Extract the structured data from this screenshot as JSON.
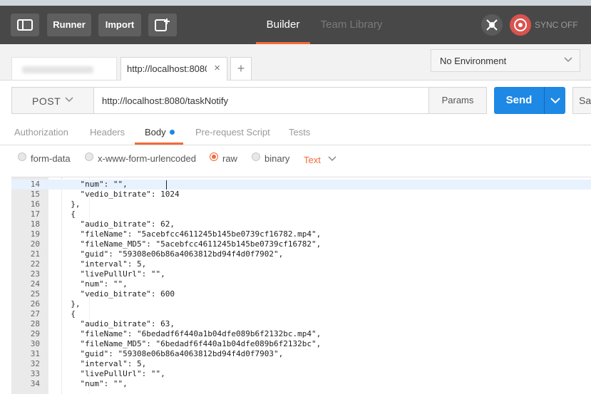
{
  "header": {
    "runner_label": "Runner",
    "import_label": "Import",
    "tabs": [
      {
        "label": "Builder",
        "active": true
      },
      {
        "label": "Team Library",
        "active": false
      }
    ],
    "sync_label": "SYNC OFF"
  },
  "tabs_row": {
    "active_tab_label": "http://localhost:8080",
    "add_tab_label": "+",
    "close_label": "×",
    "environment": "No Environment"
  },
  "request": {
    "method": "POST",
    "url": "http://localhost:8080/taskNotify",
    "params_label": "Params",
    "send_label": "Send",
    "save_label": "Sa"
  },
  "subtabs": [
    "Authorization",
    "Headers",
    "Body",
    "Pre-request Script",
    "Tests"
  ],
  "body_options": {
    "form_data": "form-data",
    "urlencoded": "x-www-form-urlencoded",
    "raw": "raw",
    "binary": "binary",
    "text_type": "Text"
  },
  "editor": {
    "lines": [
      {
        "n": "14",
        "t": "    \"num\": \"\","
      },
      {
        "n": "15",
        "t": "    \"vedio_bitrate\": 1024"
      },
      {
        "n": "16",
        "t": "  },"
      },
      {
        "n": "17",
        "t": "  {"
      },
      {
        "n": "18",
        "t": "    \"audio_bitrate\": 62,"
      },
      {
        "n": "19",
        "t": "    \"fileName\": \"5acebfcc4611245b145be0739cf16782.mp4\","
      },
      {
        "n": "20",
        "t": "    \"fileName_MD5\": \"5acebfcc4611245b145be0739cf16782\","
      },
      {
        "n": "21",
        "t": "    \"guid\": \"59308e06b86a4063812bd94f4d0f7902\","
      },
      {
        "n": "22",
        "t": "    \"interval\": 5,"
      },
      {
        "n": "23",
        "t": "    \"livePullUrl\": \"\","
      },
      {
        "n": "24",
        "t": "    \"num\": \"\","
      },
      {
        "n": "25",
        "t": "    \"vedio_bitrate\": 600"
      },
      {
        "n": "26",
        "t": "  },"
      },
      {
        "n": "27",
        "t": "  {"
      },
      {
        "n": "28",
        "t": "    \"audio_bitrate\": 63,"
      },
      {
        "n": "29",
        "t": "    \"fileName\": \"6bedadf6f440a1b04dfe089b6f2132bc.mp4\","
      },
      {
        "n": "30",
        "t": "    \"fileName_MD5\": \"6bedadf6f440a1b04dfe089b6f2132bc\","
      },
      {
        "n": "31",
        "t": "    \"guid\": \"59308e06b86a4063812bd94f4d0f7903\","
      },
      {
        "n": "32",
        "t": "    \"interval\": 5,"
      },
      {
        "n": "33",
        "t": "    \"livePullUrl\": \"\","
      },
      {
        "n": "34",
        "t": "    \"num\": \"\","
      }
    ]
  },
  "colors": {
    "accent": "#f26b3a",
    "send": "#1e88e5",
    "topbar": "#484848"
  }
}
